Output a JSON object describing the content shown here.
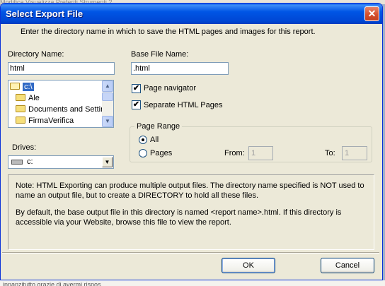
{
  "background": {
    "top_text": "Modifica   Visualizza   Preferiti   Strumenti   ?",
    "bottom_text": "innanzitutto grazie di avermi rispos"
  },
  "dialog": {
    "title": "Select Export File",
    "close_glyph": "✕",
    "instruction": "Enter the directory name in which to save the HTML pages and images for this report."
  },
  "directory": {
    "label": "Directory Name:",
    "value": "html",
    "items": [
      {
        "label": "c:\\",
        "icon": "open-folder-icon",
        "selected": true
      },
      {
        "label": "Ale",
        "icon": "folder-icon",
        "selected": false
      },
      {
        "label": "Documents and Settir",
        "icon": "folder-icon",
        "selected": false
      },
      {
        "label": "FirmaVerifica",
        "icon": "folder-icon",
        "selected": false
      }
    ]
  },
  "base_file": {
    "label": "Base File Name:",
    "value": ".html"
  },
  "options": {
    "page_navigator": {
      "label": "Page navigator",
      "checked": true
    },
    "separate_pages": {
      "label": "Separate HTML Pages",
      "checked": true
    }
  },
  "drives": {
    "label": "Drives:",
    "value": "c:",
    "icon": "drive-icon"
  },
  "page_range": {
    "title": "Page Range",
    "all_label": "All",
    "pages_label": "Pages",
    "selected": "All",
    "from_label": "From:",
    "from_value": "1",
    "to_label": "To:",
    "to_value": "1"
  },
  "note": {
    "paragraph1": "Note: HTML Exporting can produce multiple output files. The directory name specified is NOT used to name an output file, but to create a DIRECTORY to hold all these files.",
    "paragraph2": "By default, the base output file in this directory is named <report name>.html. If this directory is accessible via your Website, browse this file to view the report."
  },
  "buttons": {
    "ok": "OK",
    "cancel": "Cancel"
  },
  "checkmark": "✔",
  "scroll_up": "▲",
  "scroll_down": "▼",
  "dropdown_arrow": "▼"
}
